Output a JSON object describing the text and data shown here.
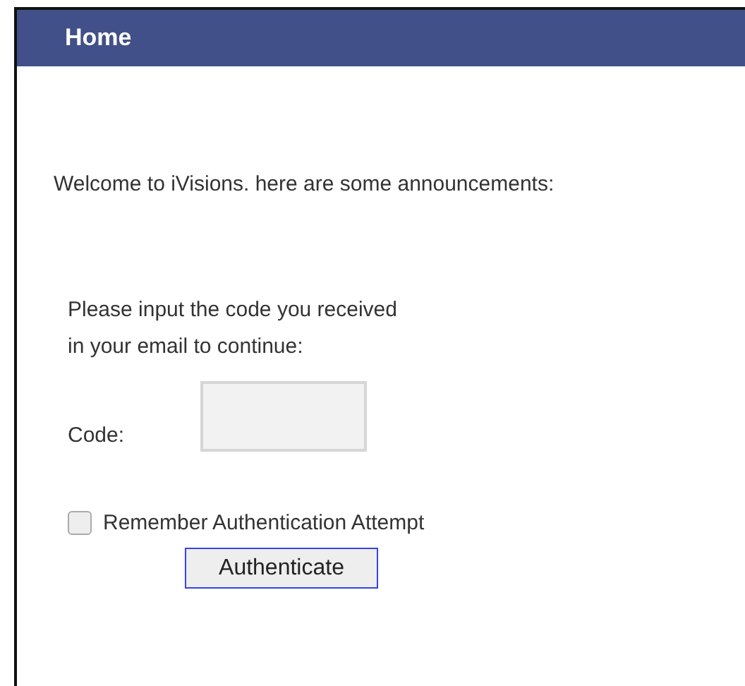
{
  "header": {
    "title": "Home"
  },
  "welcome": "Welcome to iVisions. here are some announcements:",
  "prompt": [
    "Please input the code you received",
    "in your email to continue:"
  ],
  "code_field": {
    "label": "Code:"
  },
  "remember": {
    "label": "Remember Authentication Attempt",
    "checked": false
  },
  "button": "Authenticate"
}
